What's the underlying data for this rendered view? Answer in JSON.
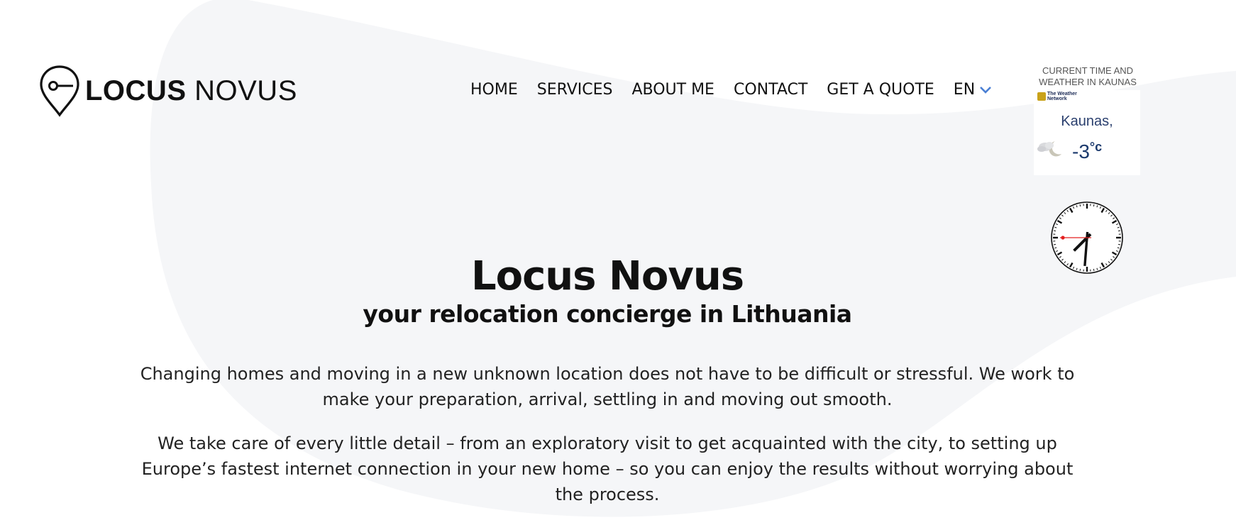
{
  "brand": {
    "name_bold": "LOCUS",
    "name_light": "NOVUS",
    "logo_icon": "location-key-icon"
  },
  "nav": {
    "items": [
      {
        "label": "HOME"
      },
      {
        "label": "SERVICES"
      },
      {
        "label": "ABOUT ME"
      },
      {
        "label": "CONTACT"
      },
      {
        "label": "GET A QUOTE"
      }
    ],
    "language": {
      "label": "EN",
      "icon": "chevron-down-icon",
      "accent": "#4a7fd4"
    }
  },
  "widget": {
    "title_line1": "CURRENT TIME AND",
    "title_line2": "WEATHER IN KAUNAS",
    "provider_line1": "The Weather",
    "provider_line2": "Network",
    "city": "Kaunas,",
    "temperature": "-3",
    "unit": "°c",
    "condition_icon": "moon-cloud-icon",
    "clock": {
      "hour": 7,
      "minute": 30,
      "second": 45
    }
  },
  "hero": {
    "title": "Locus Novus",
    "subtitle": "your relocation concierge in Lithuania",
    "paragraph1": "Changing homes and moving in a new unknown location does not have to be difficult or stressful. We work to make your preparation, arrival, settling in and moving out smooth.",
    "paragraph2": "We take care of every little detail – from an exploratory visit to get acquainted with the city, to setting up Europe’s fastest internet connection in your new home – so you can enjoy the results without worrying about the process."
  },
  "colors": {
    "background_blob": "#f5f6f8",
    "text": "#111111",
    "clock_second_hand": "#e32020"
  }
}
